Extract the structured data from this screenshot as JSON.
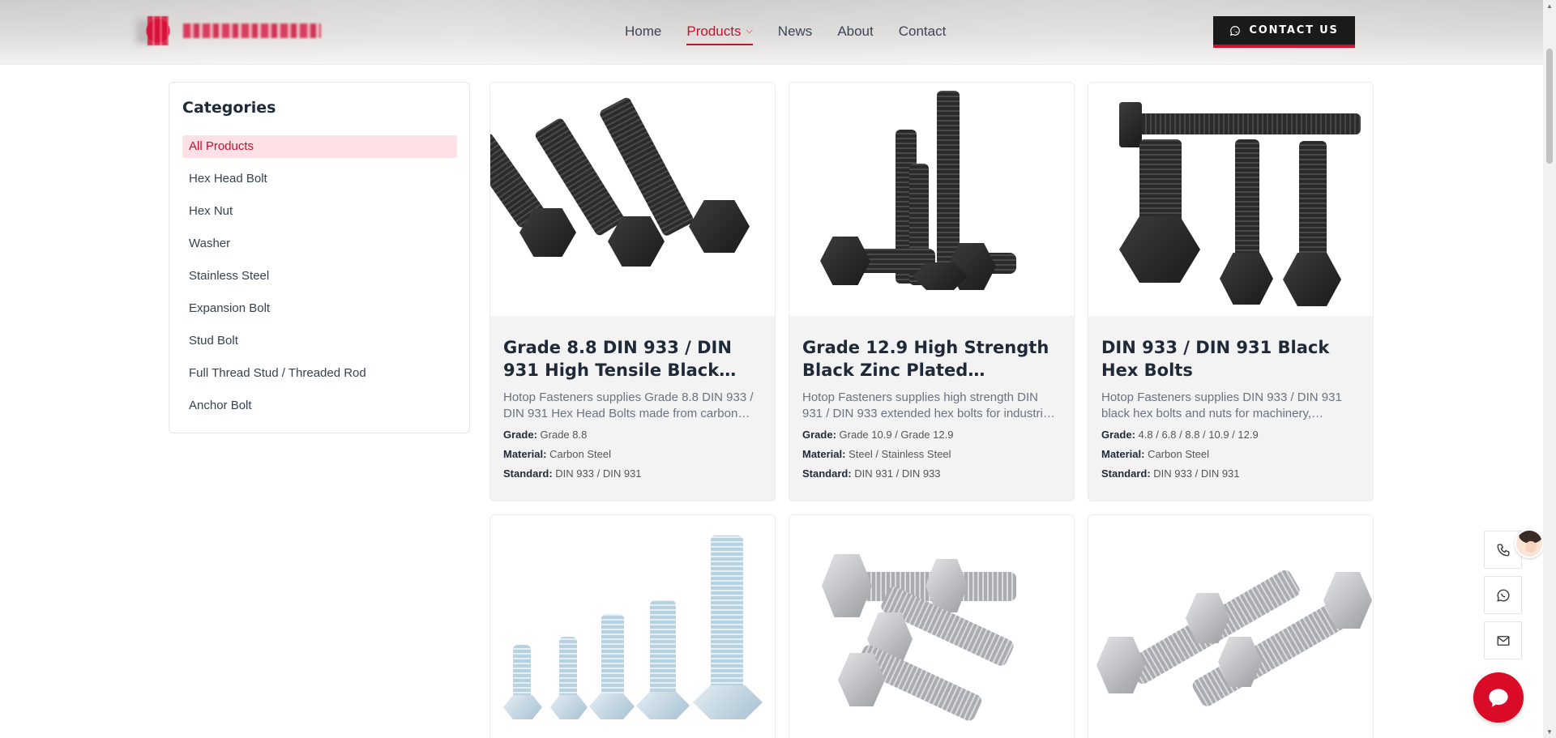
{
  "header": {
    "nav": [
      {
        "label": "Home",
        "active": false
      },
      {
        "label": "Products",
        "active": true
      },
      {
        "label": "News",
        "active": false
      },
      {
        "label": "About",
        "active": false
      },
      {
        "label": "Contact",
        "active": false
      }
    ],
    "contact_button": "CONTACT US",
    "accent_color": "#c8102e"
  },
  "sidebar": {
    "title": "Categories",
    "items": [
      {
        "label": "All Products",
        "active": true
      },
      {
        "label": "Hex Head Bolt"
      },
      {
        "label": "Hex Nut"
      },
      {
        "label": "Washer"
      },
      {
        "label": "Stainless Steel"
      },
      {
        "label": "Expansion Bolt"
      },
      {
        "label": "Stud Bolt"
      },
      {
        "label": "Full Thread Stud / Threaded Rod"
      },
      {
        "label": "Anchor Bolt"
      }
    ]
  },
  "products": [
    {
      "title": "Grade 8.8 DIN 933 / DIN 931 High Tensile Black Oxide Hex Bolts",
      "description": "Hotop Fasteners supplies Grade 8.8 DIN 933 / DIN 931 Hex Head Bolts made from carbon steel.",
      "grade_label": "Grade:",
      "grade": "Grade 8.8",
      "material_label": "Material:",
      "material": "Carbon Steel",
      "standard_label": "Standard:",
      "standard": "DIN 933 / DIN 931"
    },
    {
      "title": "Grade 12.9 High Strength Black Zinc Plated Extended Hex Bolts",
      "description": "Hotop Fasteners supplies high strength DIN 931 / DIN 933 extended hex bolts for industrial use.",
      "grade_label": "Grade:",
      "grade": "Grade 10.9 / Grade 12.9",
      "material_label": "Material:",
      "material": "Steel / Stainless Steel",
      "standard_label": "Standard:",
      "standard": "DIN 931 / DIN 933"
    },
    {
      "title": "DIN 933 / DIN 931 Black Hex Bolts",
      "description": "Hotop Fasteners supplies DIN 933 / DIN 931 black hex bolts and nuts for machinery, construction.",
      "grade_label": "Grade:",
      "grade": "4.8 / 6.8 / 8.8 / 10.9 / 12.9",
      "material_label": "Material:",
      "material": "Carbon Steel",
      "standard_label": "Standard:",
      "standard": "DIN 933 / DIN 931"
    }
  ],
  "icons": {
    "phone": "phone-icon",
    "whatsapp": "whatsapp-icon",
    "mail": "mail-icon",
    "chat": "chat-icon"
  }
}
